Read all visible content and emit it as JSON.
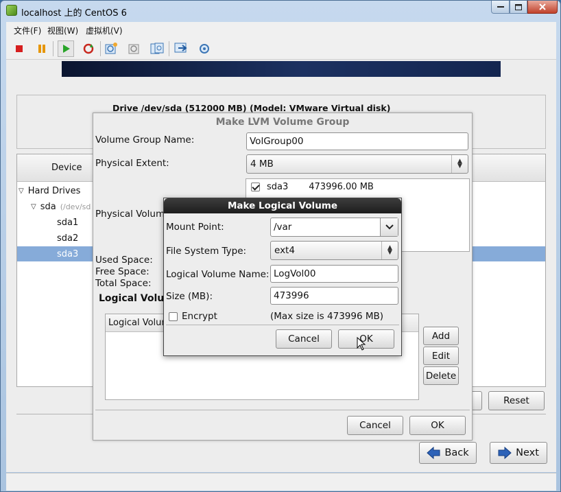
{
  "window": {
    "title": "localhost 上的 CentOS 6",
    "menu": [
      "文件(F)",
      "视图(W)",
      "虚拟机(V)"
    ]
  },
  "toolbar_icons": [
    "stop-icon",
    "pause-icon",
    "play-icon",
    "reset-icon",
    "snapshot-icon",
    "snapshot-revert-icon",
    "snapshot-manager-icon",
    "console-view-icon",
    "settings-icon"
  ],
  "installer": {
    "drive_heading": "Drive /dev/sda (512000 MB) (Model: VMware Virtual disk)",
    "list_header_device": "Device",
    "tree": [
      {
        "label": "Hard Drives"
      },
      {
        "label": "sda",
        "hint": "(/dev/sd"
      },
      {
        "label": "sda1"
      },
      {
        "label": "sda2"
      },
      {
        "label": "sda3"
      }
    ],
    "reset_button": "Reset",
    "back_button": "Back",
    "next_button": "Next"
  },
  "lvm_dialog": {
    "title": "Make LVM Volume Group",
    "vg_name_label": "Volume Group Name:",
    "vg_name_value": "VolGroup00",
    "pe_label": "Physical Extent:",
    "pe_value": "4 MB",
    "pv_label": "Physical Volum",
    "pv_items": [
      {
        "name": "sda3",
        "size": "473996.00 MB",
        "checked": true
      }
    ],
    "used_space_label": "Used Space:",
    "free_space_label": "Free Space:",
    "total_space_label": "Total Space:",
    "lv_section_label": "Logical Volu",
    "lv_column_header": "Logical Volum",
    "add_button": "Add",
    "edit_button": "Edit",
    "delete_button": "Delete",
    "cancel_button": "Cancel",
    "ok_button": "OK"
  },
  "lv_dialog": {
    "title": "Make Logical Volume",
    "mount_point_label": "Mount Point:",
    "mount_point_value": "/var",
    "fs_type_label": "File System Type:",
    "fs_type_value": "ext4",
    "lv_name_label": "Logical Volume Name:",
    "lv_name_value": "LogVol00",
    "size_label": "Size (MB):",
    "size_value": "473996",
    "encrypt_label": "Encrypt",
    "encrypt_checked": false,
    "max_size_text": "(Max size is 473996 MB)",
    "cancel_button": "Cancel",
    "ok_button": "OK"
  },
  "colors": {
    "selection": "#86abd9",
    "banner": "#1c3161",
    "dialog_title_bg": "#1d1d1d"
  }
}
